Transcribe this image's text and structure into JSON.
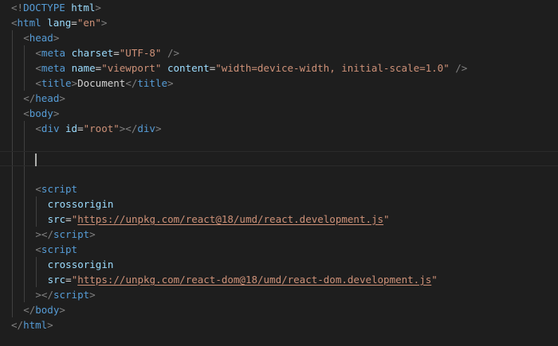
{
  "editor": {
    "lines": [
      {
        "indent": 0,
        "tokens": [
          [
            "t-br",
            "<!"
          ],
          [
            "t-tag",
            "DOCTYPE"
          ],
          [
            "t-txt",
            " "
          ],
          [
            "t-attr",
            "html"
          ],
          [
            "t-br",
            ">"
          ]
        ]
      },
      {
        "indent": 0,
        "tokens": [
          [
            "t-br",
            "<"
          ],
          [
            "t-tag",
            "html"
          ],
          [
            "t-txt",
            " "
          ],
          [
            "t-attr",
            "lang"
          ],
          [
            "t-txt",
            "="
          ],
          [
            "t-str",
            "\"en\""
          ],
          [
            "t-br",
            ">"
          ]
        ]
      },
      {
        "indent": 1,
        "tokens": [
          [
            "t-br",
            "<"
          ],
          [
            "t-tag",
            "head"
          ],
          [
            "t-br",
            ">"
          ]
        ]
      },
      {
        "indent": 2,
        "tokens": [
          [
            "t-br",
            "<"
          ],
          [
            "t-tag",
            "meta"
          ],
          [
            "t-txt",
            " "
          ],
          [
            "t-attr",
            "charset"
          ],
          [
            "t-txt",
            "="
          ],
          [
            "t-str",
            "\"UTF-8\""
          ],
          [
            "t-txt",
            " "
          ],
          [
            "t-br",
            "/>"
          ]
        ]
      },
      {
        "indent": 2,
        "tokens": [
          [
            "t-br",
            "<"
          ],
          [
            "t-tag",
            "meta"
          ],
          [
            "t-txt",
            " "
          ],
          [
            "t-attr",
            "name"
          ],
          [
            "t-txt",
            "="
          ],
          [
            "t-str",
            "\"viewport\""
          ],
          [
            "t-txt",
            " "
          ],
          [
            "t-attr",
            "content"
          ],
          [
            "t-txt",
            "="
          ],
          [
            "t-str",
            "\"width=device-width, initial-scale=1.0\""
          ],
          [
            "t-txt",
            " "
          ],
          [
            "t-br",
            "/>"
          ]
        ]
      },
      {
        "indent": 2,
        "tokens": [
          [
            "t-br",
            "<"
          ],
          [
            "t-tag",
            "title"
          ],
          [
            "t-br",
            ">"
          ],
          [
            "t-txt",
            "Document"
          ],
          [
            "t-br",
            "</"
          ],
          [
            "t-tag",
            "title"
          ],
          [
            "t-br",
            ">"
          ]
        ]
      },
      {
        "indent": 1,
        "tokens": [
          [
            "t-br",
            "</"
          ],
          [
            "t-tag",
            "head"
          ],
          [
            "t-br",
            ">"
          ]
        ]
      },
      {
        "indent": 1,
        "tokens": [
          [
            "t-br",
            "<"
          ],
          [
            "t-tag",
            "body"
          ],
          [
            "t-br",
            ">"
          ]
        ]
      },
      {
        "indent": 2,
        "tokens": [
          [
            "t-br",
            "<"
          ],
          [
            "t-tag",
            "div"
          ],
          [
            "t-txt",
            " "
          ],
          [
            "t-attr",
            "id"
          ],
          [
            "t-txt",
            "="
          ],
          [
            "t-str",
            "\"root\""
          ],
          [
            "t-br",
            "></"
          ],
          [
            "t-tag",
            "div"
          ],
          [
            "t-br",
            ">"
          ]
        ]
      },
      {
        "indent": 2,
        "tokens": []
      },
      {
        "indent": 2,
        "tokens": [],
        "current": true
      },
      {
        "indent": 2,
        "tokens": []
      },
      {
        "indent": 2,
        "tokens": [
          [
            "t-br",
            "<"
          ],
          [
            "t-tag",
            "script"
          ]
        ]
      },
      {
        "indent": 3,
        "tokens": [
          [
            "t-attr",
            "crossorigin"
          ]
        ]
      },
      {
        "indent": 3,
        "tokens": [
          [
            "t-attr",
            "src"
          ],
          [
            "t-txt",
            "="
          ],
          [
            "t-str",
            "\""
          ],
          [
            "t-link",
            "https://unpkg.com/react@18/umd/react.development.js"
          ],
          [
            "t-str",
            "\""
          ]
        ]
      },
      {
        "indent": 2,
        "tokens": [
          [
            "t-br",
            "></"
          ],
          [
            "t-tag",
            "script"
          ],
          [
            "t-br",
            ">"
          ]
        ]
      },
      {
        "indent": 2,
        "tokens": [
          [
            "t-br",
            "<"
          ],
          [
            "t-tag",
            "script"
          ]
        ]
      },
      {
        "indent": 3,
        "tokens": [
          [
            "t-attr",
            "crossorigin"
          ]
        ]
      },
      {
        "indent": 3,
        "tokens": [
          [
            "t-attr",
            "src"
          ],
          [
            "t-txt",
            "="
          ],
          [
            "t-str",
            "\""
          ],
          [
            "t-link",
            "https://unpkg.com/react-dom@18/umd/react-dom.development.js"
          ],
          [
            "t-str",
            "\""
          ]
        ]
      },
      {
        "indent": 2,
        "tokens": [
          [
            "t-br",
            "></"
          ],
          [
            "t-tag",
            "script"
          ],
          [
            "t-br",
            ">"
          ]
        ]
      },
      {
        "indent": 1,
        "tokens": [
          [
            "t-br",
            "</"
          ],
          [
            "t-tag",
            "body"
          ],
          [
            "t-br",
            ">"
          ]
        ]
      },
      {
        "indent": 0,
        "tokens": [
          [
            "t-br",
            "</"
          ],
          [
            "t-tag",
            "html"
          ],
          [
            "t-br",
            ">"
          ]
        ]
      }
    ],
    "colors": {
      "background": "#1e1e1e",
      "tag": "#569cd6",
      "attribute": "#9cdcfe",
      "string": "#ce9178",
      "bracket": "#808080",
      "text": "#d4d4d4"
    }
  }
}
